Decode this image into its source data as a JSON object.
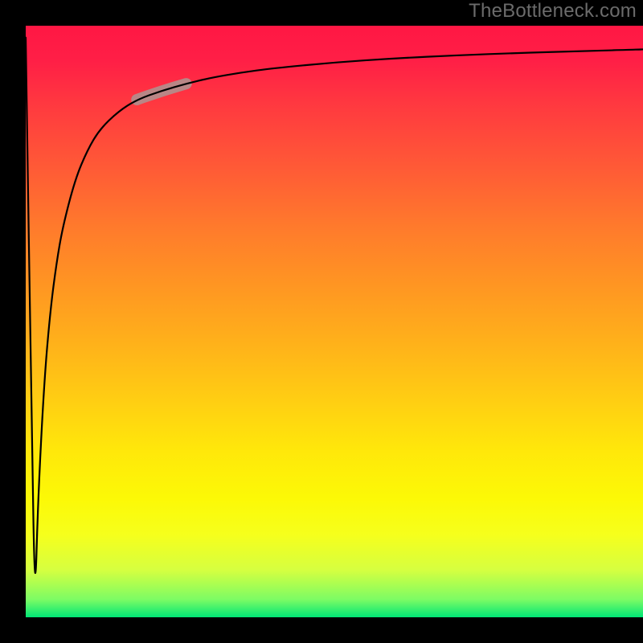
{
  "attribution": "TheBottleneck.com",
  "chart_data": {
    "type": "line",
    "title": "",
    "xlabel": "",
    "ylabel": "",
    "xlim": [
      0,
      100
    ],
    "ylim": [
      0,
      100
    ],
    "grid": false,
    "legend": false,
    "series": [
      {
        "name": "curve",
        "x": [
          0,
          1,
          1.5,
          2,
          3,
          4,
          5,
          6,
          8,
          10,
          12,
          15,
          18,
          22,
          26,
          30,
          35,
          40,
          50,
          60,
          70,
          80,
          90,
          100
        ],
        "values": [
          98,
          30,
          2,
          20,
          40,
          52,
          60,
          66,
          74,
          79,
          82.5,
          85.5,
          87.5,
          89,
          90.2,
          91.2,
          92.1,
          92.8,
          93.8,
          94.5,
          95,
          95.4,
          95.7,
          96
        ]
      }
    ],
    "highlight_segment": {
      "x_start": 18,
      "x_end": 26,
      "color": "#b98686"
    },
    "background_gradient": {
      "top": "#ff1744",
      "mid": "#ffd600",
      "bottom": "#00e676"
    }
  }
}
